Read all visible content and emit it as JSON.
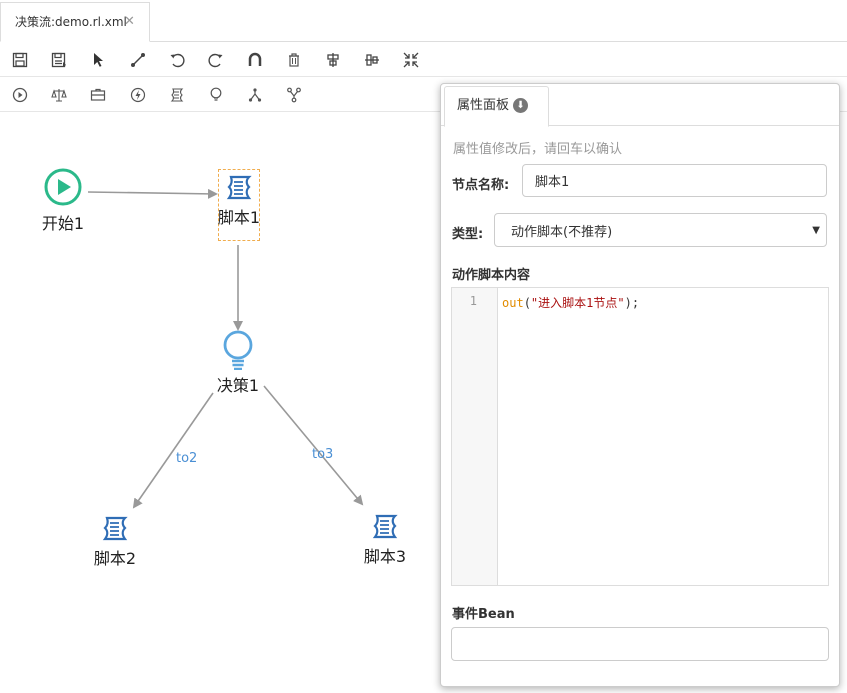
{
  "tab": {
    "title": "决策流:demo.rl.xml",
    "close": "✕"
  },
  "toolbar1": {
    "items": [
      "save-icon",
      "save-as-icon",
      "select-pointer-icon",
      "connect-line-icon",
      "undo-icon",
      "redo-icon",
      "magnet-icon",
      "delete-icon",
      "align-center-icon",
      "align-middle-icon",
      "shrink-icon"
    ]
  },
  "toolbar2": {
    "items": [
      "start-node-icon",
      "rule-node-icon",
      "package-node-icon",
      "action-node-icon",
      "script-node-icon",
      "decision-node-icon",
      "fork-node-icon",
      "join-node-icon"
    ]
  },
  "canvas": {
    "nodes": {
      "start1": "开始1",
      "script1": "脚本1",
      "decision1": "决策1",
      "script2": "脚本2",
      "script3": "脚本3"
    },
    "edges": {
      "to2": "to2",
      "to3": "to3"
    }
  },
  "panel": {
    "tab_label": "属性面板",
    "hint": "属性值修改后，请回车以确认",
    "name_label": "节点名称:",
    "name_value": "脚本1",
    "type_label": "类型:",
    "type_value": "动作脚本(不推荐)",
    "script_label": "动作脚本内容",
    "line_number": "1",
    "code_fn": "out",
    "code_open": "(",
    "code_str": "\"进入脚本1节点\"",
    "code_close": ");",
    "bean_label": "事件Bean",
    "bean_value": ""
  },
  "colors": {
    "start": "#2bb98a",
    "script": "#2f6db5",
    "decision": "#5aa6de",
    "edge": "#999999",
    "accent": "#4a8fd4",
    "selected": "#f0ad4e"
  }
}
